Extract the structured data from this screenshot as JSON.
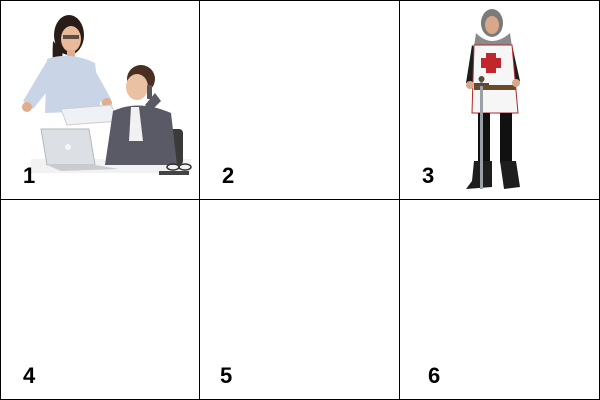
{
  "cells": [
    {
      "number": "1",
      "image": "office-workers-image"
    },
    {
      "number": "2",
      "image": ""
    },
    {
      "number": "3",
      "image": "knight-costume-image"
    },
    {
      "number": "4",
      "image": ""
    },
    {
      "number": "5",
      "image": ""
    },
    {
      "number": "6",
      "image": ""
    }
  ]
}
